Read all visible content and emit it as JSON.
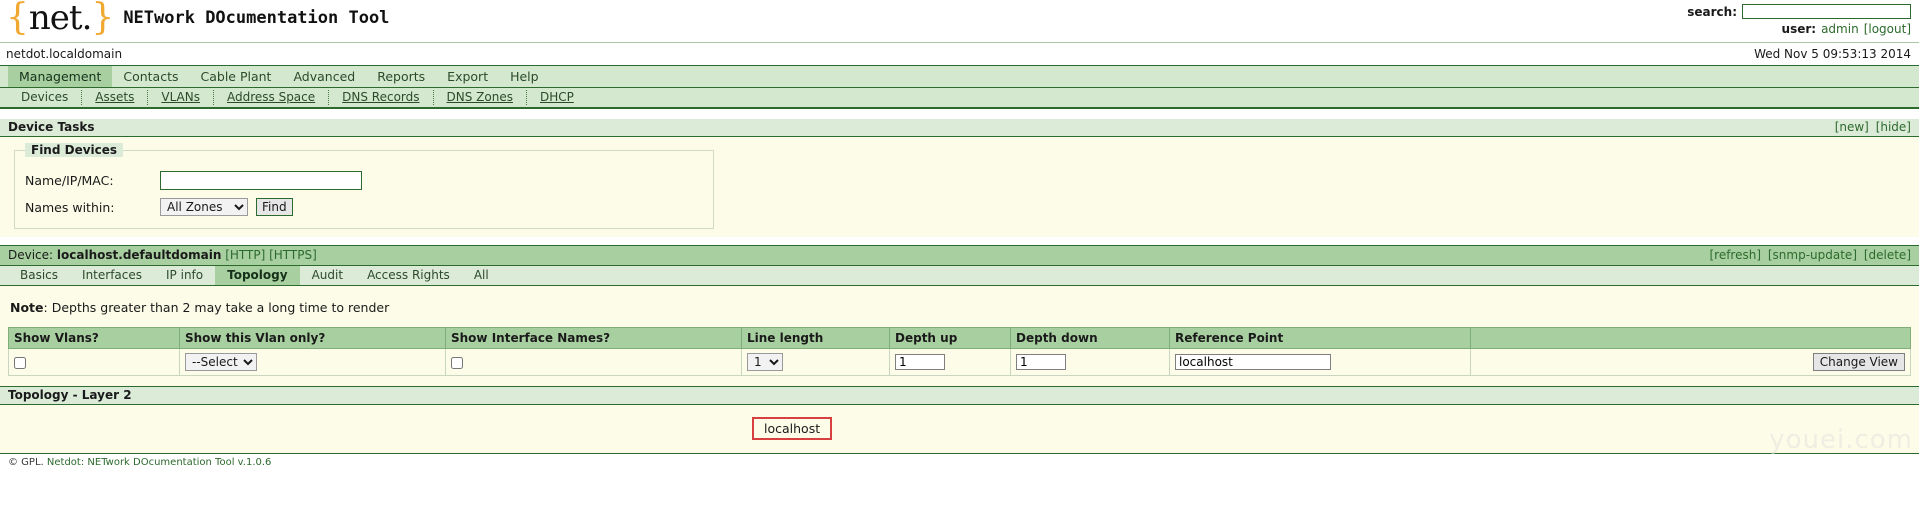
{
  "header": {
    "logo_brace_open": "{",
    "logo_text": "net.",
    "logo_brace_close": "}",
    "app_title": "NETwork DOcumentation Tool",
    "search_label": "search:",
    "search_value": "",
    "user_label": "user:",
    "user_name": "admin",
    "logout_label": "[logout]",
    "domain": "netdot.localdomain",
    "datetime": "Wed Nov 5 09:53:13 2014"
  },
  "mainnav": {
    "items": [
      {
        "label": "Management",
        "active": true
      },
      {
        "label": "Contacts",
        "active": false
      },
      {
        "label": "Cable Plant",
        "active": false
      },
      {
        "label": "Advanced",
        "active": false
      },
      {
        "label": "Reports",
        "active": false
      },
      {
        "label": "Export",
        "active": false
      },
      {
        "label": "Help",
        "active": false
      }
    ]
  },
  "subnav": {
    "items": [
      {
        "label": "Devices",
        "current": true
      },
      {
        "label": "Assets",
        "current": false
      },
      {
        "label": "VLANs",
        "current": false
      },
      {
        "label": "Address Space",
        "current": false
      },
      {
        "label": "DNS Records",
        "current": false
      },
      {
        "label": "DNS Zones",
        "current": false
      },
      {
        "label": "DHCP",
        "current": false
      }
    ]
  },
  "device_tasks": {
    "title": "Device Tasks",
    "new_label": "[new]",
    "hide_label": "[hide]",
    "fieldset_legend": "Find Devices",
    "name_label": "Name/IP/MAC:",
    "name_value": "",
    "zones_label": "Names within:",
    "zones_selected": "All Zones",
    "zones_options": [
      "All Zones"
    ],
    "find_button": "Find"
  },
  "device": {
    "prefix": "Device:",
    "name": "localhost.defaultdomain",
    "http_link": "[HTTP]",
    "https_link": "[HTTPS]",
    "refresh_link": "[refresh]",
    "snmp_update_link": "[snmp-update]",
    "delete_link": "[delete]",
    "tabs": [
      {
        "label": "Basics",
        "active": false
      },
      {
        "label": "Interfaces",
        "active": false
      },
      {
        "label": "IP info",
        "active": false
      },
      {
        "label": "Topology",
        "active": true
      },
      {
        "label": "Audit",
        "active": false
      },
      {
        "label": "Access Rights",
        "active": false
      },
      {
        "label": "All",
        "active": false
      }
    ]
  },
  "topology": {
    "note_prefix": "Note",
    "note_text": ": Depths greater than 2 may take a long time to render",
    "columns": [
      "Show Vlans?",
      "Show this Vlan only?",
      "Show Interface Names?",
      "Line length",
      "Depth up",
      "Depth down",
      "Reference Point",
      ""
    ],
    "show_vlans_checked": false,
    "vlan_selected": "--Select--",
    "vlan_options": [
      "--Select--"
    ],
    "show_iface_names_checked": false,
    "line_length_selected": "1",
    "line_length_options": [
      "1"
    ],
    "depth_up_value": "1",
    "depth_down_value": "1",
    "reference_point_value": "localhost",
    "change_view_button": "Change View",
    "layer_title": "Topology - Layer 2",
    "node_label": "localhost",
    "node_border_color": "#d84040",
    "watermark": "youei.com"
  },
  "footer": {
    "copyright": "© GPL.",
    "link_text": "Netdot: NETwork DOcumentation Tool v.1.0.6"
  },
  "colors": {
    "nav_bg": "#d4e8d0",
    "nav_active": "#a8cfa0",
    "panel_bg": "#fcfce8",
    "border_green": "#2d6a2d",
    "logo_orange": "#f0a830"
  }
}
